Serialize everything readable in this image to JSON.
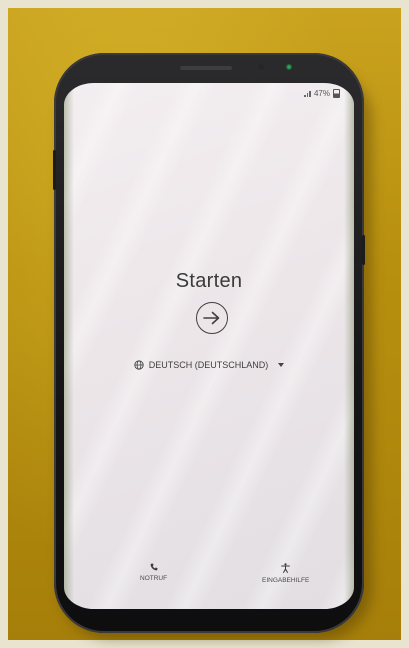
{
  "status_bar": {
    "battery_text": "47%",
    "signal_icon": "signal-bars-icon",
    "battery_icon": "battery-icon"
  },
  "setup": {
    "title": "Starten",
    "start_icon": "arrow-right-circle-icon"
  },
  "language": {
    "icon": "globe-icon",
    "selected": "DEUTSCH (DEUTSCHLAND)",
    "dropdown_icon": "caret-down-icon"
  },
  "bottom": {
    "emergency_label": "NOTRUF",
    "emergency_icon": "phone-icon",
    "accessibility_label": "EINGABEHILFE",
    "accessibility_icon": "accessibility-icon"
  },
  "colors": {
    "background_table": "#b8900f",
    "phone_body": "#151516",
    "screen": "#efeaec",
    "text": "#3a3a3a"
  }
}
